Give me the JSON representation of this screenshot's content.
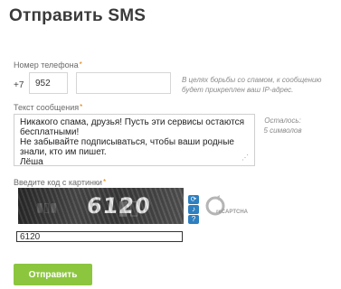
{
  "page": {
    "title": "Отправить SMS"
  },
  "phone": {
    "label": "Номер телефона",
    "required_mark": "*",
    "prefix": "+7",
    "code_value": "952",
    "number_value": "",
    "hint": "В целях борьбы со спамом, к сообщению будет прикреплен ваш IP-адрес."
  },
  "message": {
    "label": "Текст сообщения",
    "required_mark": "*",
    "value": "Никакого спама, друзья! Пусть эти сервисы остаются бесплатными!\nНе забывайте подписываться, чтобы ваши родные знали, кто им пишет.\nЛёша",
    "remaining": "Осталось: 5 символов"
  },
  "captcha": {
    "label": "Введите код с картинки",
    "required_mark": "*",
    "image_text": "6120",
    "input_value": "6120",
    "logo_text": "reCAPTCHA"
  },
  "submit": {
    "label": "Отправить"
  },
  "colors": {
    "accent_green": "#8cc63f",
    "required": "#e07b00",
    "captcha_button": "#2e7fbf"
  }
}
